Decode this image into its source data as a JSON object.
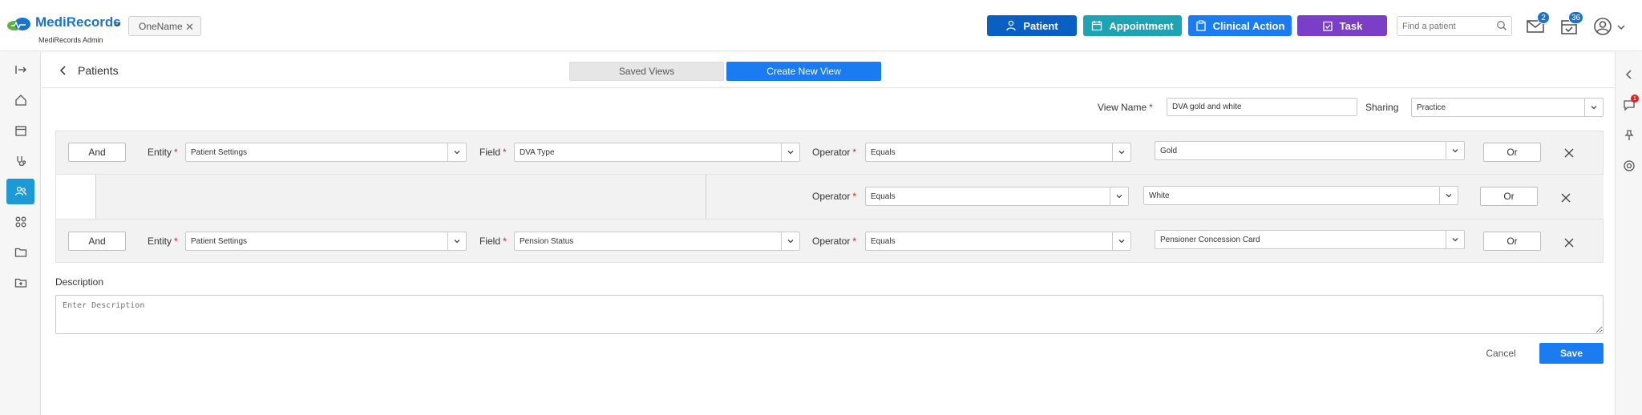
{
  "header": {
    "brand": "MediRecords",
    "brand_sub": "MediRecords Admin",
    "org_chip": "OneName",
    "buttons": [
      {
        "label": "Patient",
        "color": "#0a5fc2",
        "icon": "person-icon"
      },
      {
        "label": "Appointment",
        "color": "#1ea3b4",
        "icon": "calendar-icon"
      },
      {
        "label": "Clinical Action",
        "color": "#1a7cf0",
        "icon": "clipboard-icon"
      },
      {
        "label": "Task",
        "color": "#7a3fc6",
        "icon": "task-icon"
      }
    ],
    "search_placeholder": "Find a patient",
    "mail_count": "2",
    "tasks_count": "36"
  },
  "page": {
    "title": "Patients",
    "tab_saved": "Saved Views",
    "tab_create": "Create New View"
  },
  "form": {
    "view_name_label": "View Name",
    "view_name_value": "DVA gold and white",
    "sharing_label": "Sharing",
    "sharing_value": "Practice",
    "entity_label": "Entity",
    "field_label": "Field",
    "operator_label": "Operator",
    "and_label": "And",
    "or_label": "Or",
    "rules": [
      {
        "entity": "Patient Settings",
        "field": "DVA Type",
        "operator": "Equals",
        "value": "Gold"
      },
      {
        "operator": "Equals",
        "value": "White"
      },
      {
        "entity": "Patient Settings",
        "field": "Pension Status",
        "operator": "Equals",
        "value": "Pensioner Concession Card"
      }
    ],
    "description_label": "Description",
    "description_placeholder": "Enter Description",
    "cancel_label": "Cancel",
    "save_label": "Save"
  },
  "right_rail": {
    "notification_count": "1"
  },
  "colors": {
    "primary": "#1a7cf0",
    "active_rail": "#1b9ad6"
  }
}
